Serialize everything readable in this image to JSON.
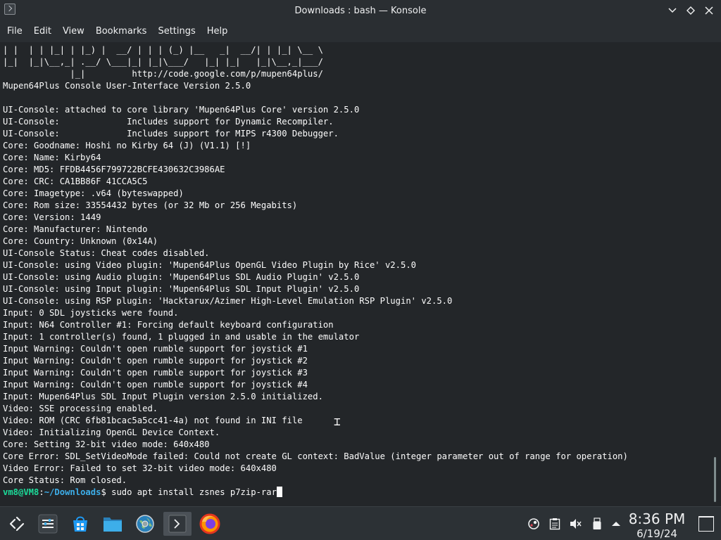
{
  "window": {
    "title": "Downloads : bash — Konsole",
    "controls": [
      "chevron-down",
      "restore",
      "close"
    ]
  },
  "menu": [
    "File",
    "Edit",
    "View",
    "Bookmarks",
    "Settings",
    "Help"
  ],
  "terminal": {
    "lines": [
      "| |  | | |_| | |_) |  __/ | | | (_) |__   _|  __/| | |_| \\__ \\",
      "|_|  |_|\\__,_| .__/ \\___|_| |_|\\___/   |_| |_|   |_|\\__,_|___/",
      "             |_|         http://code.google.com/p/mupen64plus/",
      "Mupen64Plus Console User-Interface Version 2.5.0",
      "",
      "UI-Console: attached to core library 'Mupen64Plus Core' version 2.5.0",
      "UI-Console:             Includes support for Dynamic Recompiler.",
      "UI-Console:             Includes support for MIPS r4300 Debugger.",
      "Core: Goodname: Hoshi no Kirby 64 (J) (V1.1) [!]",
      "Core: Name: Kirby64",
      "Core: MD5: FFDB4456F799722BCFE430632C3986AE",
      "Core: CRC: CA1BB86F 41CCA5C5",
      "Core: Imagetype: .v64 (byteswapped)",
      "Core: Rom size: 33554432 bytes (or 32 Mb or 256 Megabits)",
      "Core: Version: 1449",
      "Core: Manufacturer: Nintendo",
      "Core: Country: Unknown (0x14A)",
      "UI-Console Status: Cheat codes disabled.",
      "UI-Console: using Video plugin: 'Mupen64Plus OpenGL Video Plugin by Rice' v2.5.0",
      "UI-Console: using Audio plugin: 'Mupen64Plus SDL Audio Plugin' v2.5.0",
      "UI-Console: using Input plugin: 'Mupen64Plus SDL Input Plugin' v2.5.0",
      "UI-Console: using RSP plugin: 'Hacktarux/Azimer High-Level Emulation RSP Plugin' v2.5.0",
      "Input: 0 SDL joysticks were found.",
      "Input: N64 Controller #1: Forcing default keyboard configuration",
      "Input: 1 controller(s) found, 1 plugged in and usable in the emulator",
      "Input Warning: Couldn't open rumble support for joystick #1",
      "Input Warning: Couldn't open rumble support for joystick #2",
      "Input Warning: Couldn't open rumble support for joystick #3",
      "Input Warning: Couldn't open rumble support for joystick #4",
      "Input: Mupen64Plus SDL Input Plugin version 2.5.0 initialized.",
      "Video: SSE processing enabled.",
      "Video: ROM (CRC 6fb81bcac5a5cc41-4a) not found in INI file",
      "Video: Initializing OpenGL Device Context.",
      "Core: Setting 32-bit video mode: 640x480",
      "Core Error: SDL_SetVideoMode failed: Could not create GL context: BadValue (integer parameter out of range for operation)",
      "Video Error: Failed to set 32-bit video mode: 640x480",
      "Core Status: Rom closed."
    ],
    "prompt": {
      "user": "vm8@VM8",
      "separator": ":",
      "path": "~/Downloads",
      "symbol": "$",
      "command": " sudo apt install zsnes p7zip-rar"
    }
  },
  "taskbar": {
    "launchers": [
      "application-launcher-icon",
      "system-settings-icon",
      "discover-store-icon",
      "file-manager-icon",
      "network-globe-icon",
      "konsole-terminal-icon",
      "firefox-icon"
    ],
    "tray": [
      "steam-icon",
      "clipboard-icon",
      "volume-muted-icon",
      "usb-device-icon",
      "tray-expand-icon"
    ],
    "clock": {
      "time": "8:36 PM",
      "date": "6/19/24"
    }
  },
  "colors": {
    "background": "#232629",
    "text": "#fcfcfc",
    "prompt_user": "#1cdc9a",
    "prompt_path": "#3daee9"
  }
}
